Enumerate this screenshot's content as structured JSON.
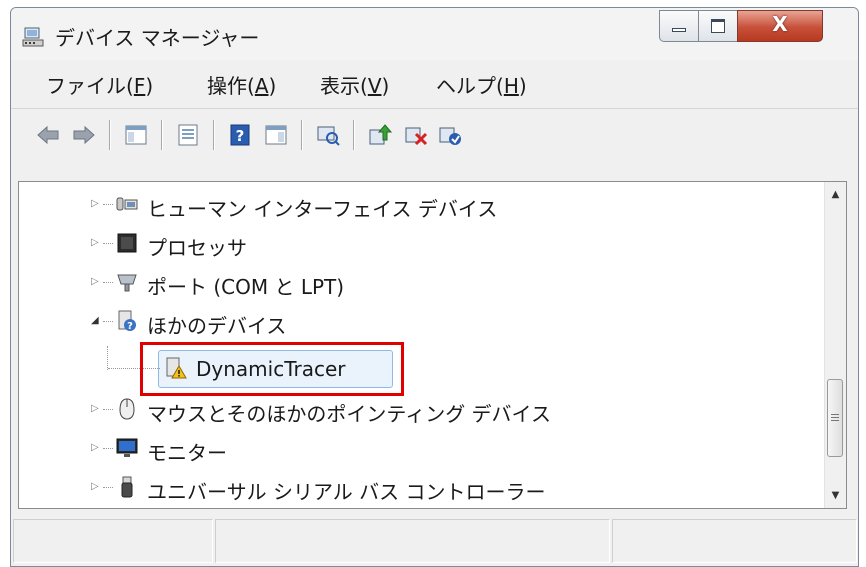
{
  "window": {
    "title": "デバイス マネージャー",
    "caption_buttons": {
      "minimize": "—",
      "maximize": "□",
      "close": "X"
    }
  },
  "menu": [
    {
      "label": "ファイル(",
      "key": "F",
      "suffix": ")"
    },
    {
      "label": "操作(",
      "key": "A",
      "suffix": ")"
    },
    {
      "label": "表示(",
      "key": "V",
      "suffix": ")"
    },
    {
      "label": "ヘルプ(",
      "key": "H",
      "suffix": ")"
    }
  ],
  "toolbar": {
    "icons": [
      "back-arrow-icon",
      "forward-arrow-icon",
      "show-hide-console-tree-icon",
      "properties-icon",
      "help-icon",
      "show-action-pane-icon",
      "scan-hardware-icon",
      "update-driver-icon",
      "uninstall-device-icon",
      "enable-device-icon"
    ]
  },
  "tree": {
    "items": [
      {
        "label": "ヒューマン インターフェイス デバイス",
        "icon": "hid-device-icon",
        "expanded": false
      },
      {
        "label": "プロセッサ",
        "icon": "processor-icon",
        "expanded": false
      },
      {
        "label": "ポート (COM と LPT)",
        "icon": "port-icon",
        "expanded": false
      },
      {
        "label": "ほかのデバイス",
        "icon": "unknown-device-icon",
        "expanded": true
      },
      {
        "label": "DynamicTracer",
        "icon": "device-warning-icon",
        "child": true,
        "selected": true
      },
      {
        "label": "マウスとそのほかのポインティング デバイス",
        "icon": "mouse-icon",
        "expanded": false
      },
      {
        "label": "モニター",
        "icon": "monitor-icon",
        "expanded": false
      },
      {
        "label": "ユニバーサル シリアル バス コントローラー",
        "icon": "usb-icon",
        "expanded": false
      }
    ]
  },
  "colors": {
    "highlight_frame": "#e00000",
    "selection": "#eaf3fc"
  }
}
